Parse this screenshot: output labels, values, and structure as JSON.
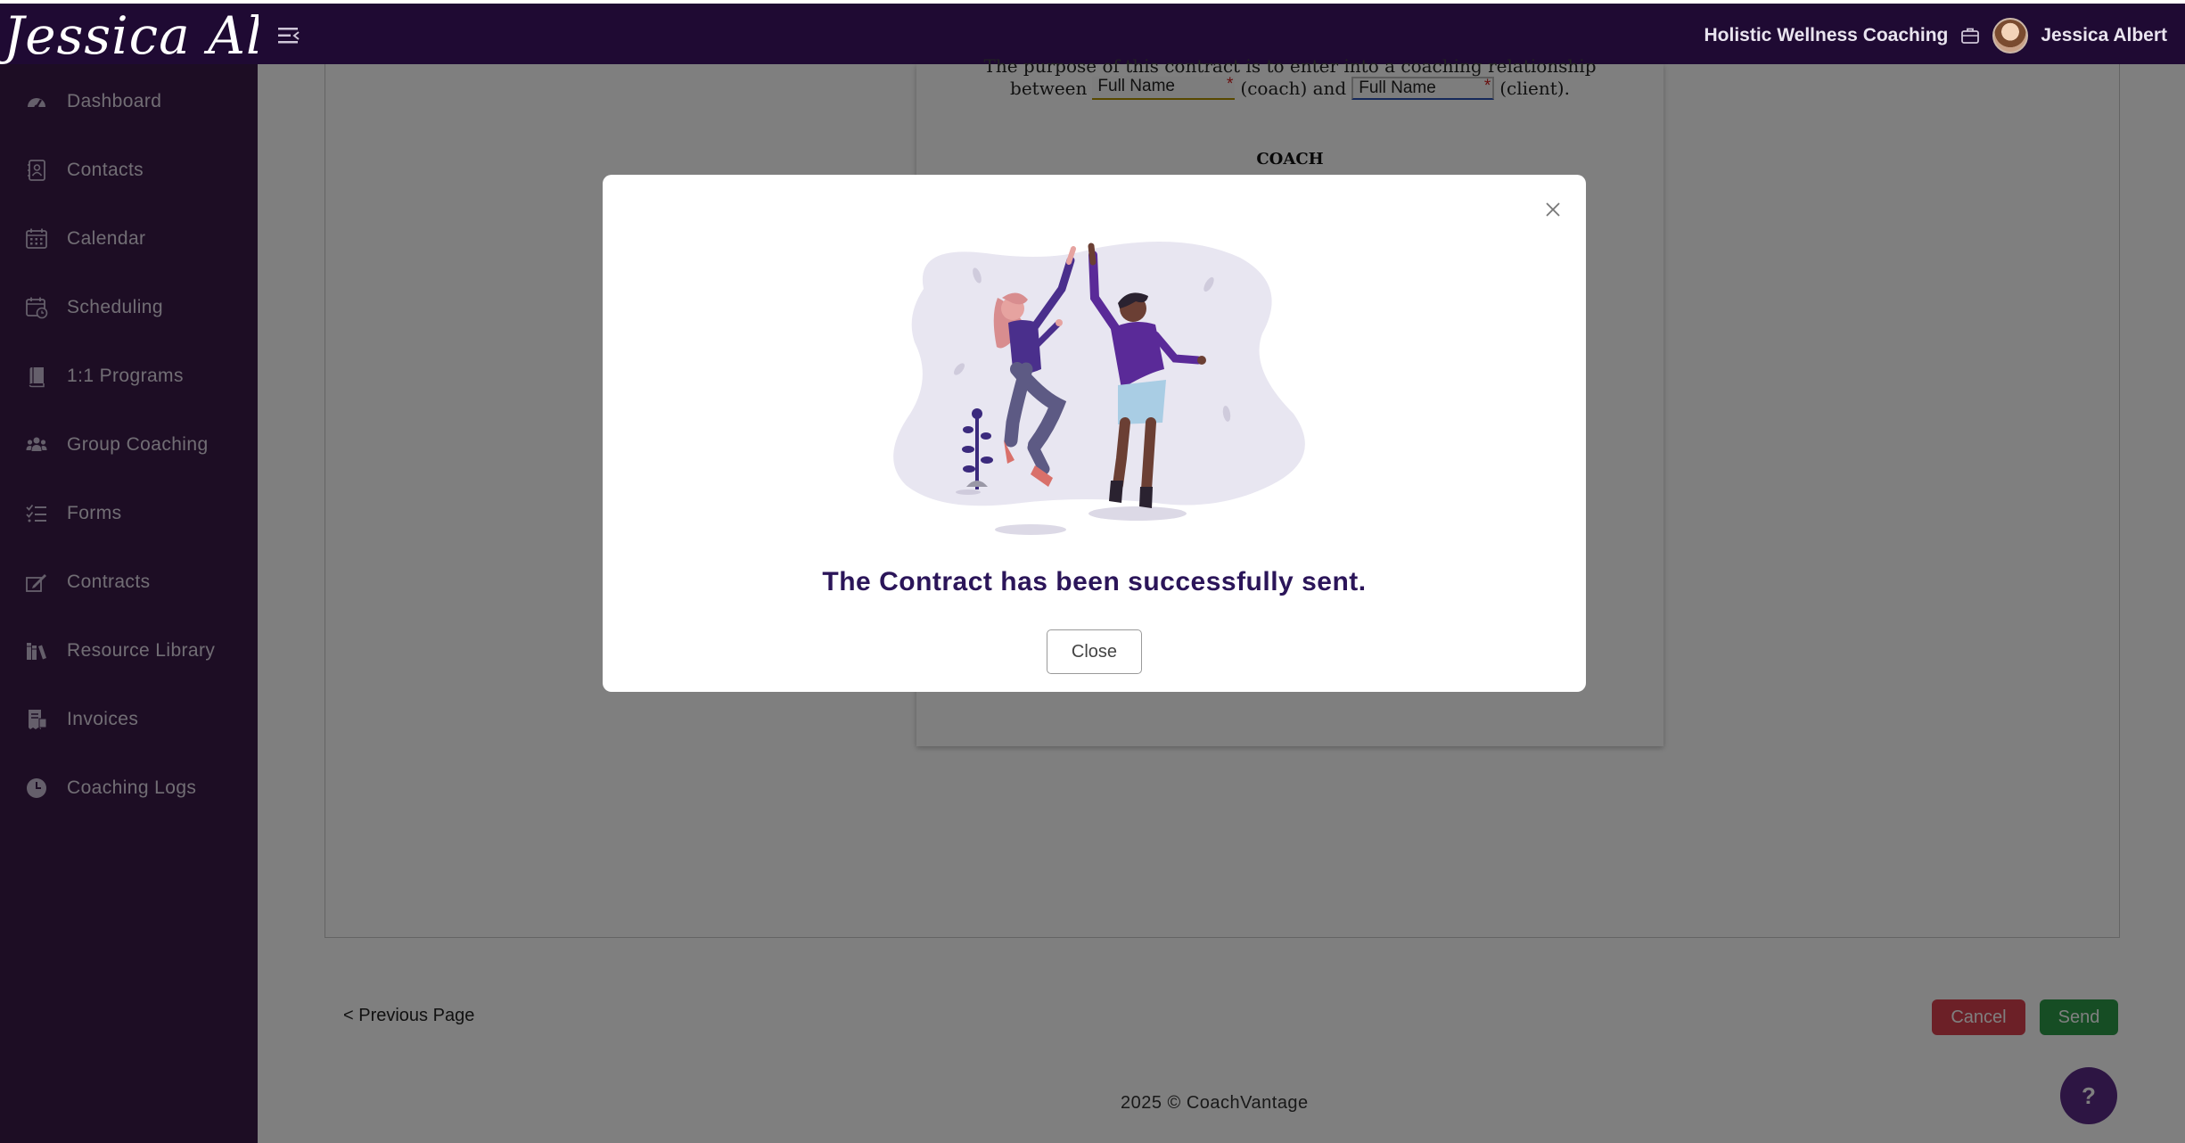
{
  "topbar": {
    "logo_text": "Jessica Albert",
    "business_name": "Holistic Wellness Coaching",
    "user_name": "Jessica Albert"
  },
  "sidebar": {
    "items": [
      {
        "label": "Dashboard",
        "icon": "dashboard-gauge-icon"
      },
      {
        "label": "Contacts",
        "icon": "address-book-icon"
      },
      {
        "label": "Calendar",
        "icon": "calendar-icon"
      },
      {
        "label": "Scheduling",
        "icon": "calendar-clock-icon"
      },
      {
        "label": "1:1 Programs",
        "icon": "book-icon"
      },
      {
        "label": "Group Coaching",
        "icon": "users-group-icon"
      },
      {
        "label": "Forms",
        "icon": "checklist-icon"
      },
      {
        "label": "Contracts",
        "icon": "signature-icon"
      },
      {
        "label": "Resource Library",
        "icon": "books-icon"
      },
      {
        "label": "Invoices",
        "icon": "invoice-icon"
      },
      {
        "label": "Coaching Logs",
        "icon": "clock-icon"
      }
    ]
  },
  "document": {
    "line1": "The purpose of this contract is to enter into a coaching relationship",
    "between": "between",
    "coach_field": "Full Name",
    "coach_suffix": "(coach) and",
    "client_field": "Full Name",
    "client_suffix": "(client).",
    "required_mark": "*",
    "section_heading": "COACH"
  },
  "actions": {
    "previous_page": "< Previous Page",
    "cancel": "Cancel",
    "send": "Send"
  },
  "footer": {
    "text": "2025 © CoachVantage"
  },
  "help": {
    "label": "?"
  },
  "modal": {
    "message": "The Contract has been successfully sent.",
    "close_label": "Close"
  },
  "colors": {
    "topbar_bg": "#1f0a33",
    "sidebar_bg": "#3a1a48",
    "modal_text": "#2b1559",
    "cancel": "#d9414e",
    "send": "#2c9b49",
    "help": "#5b2b86"
  }
}
